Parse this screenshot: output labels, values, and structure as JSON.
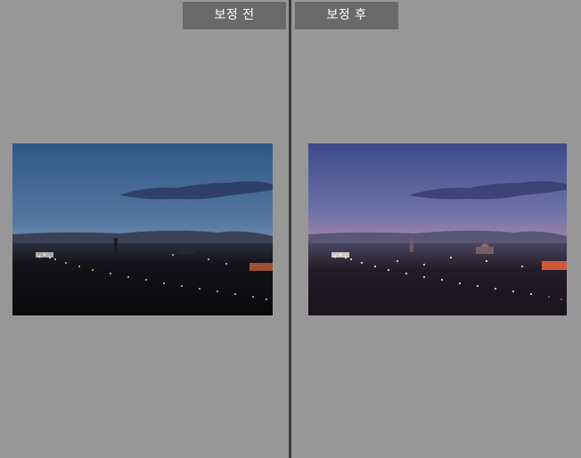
{
  "comparison": {
    "before_label": "보정 전",
    "after_label": "보정 후"
  },
  "photos": {
    "before": {
      "icon": "photo-city-dusk-before",
      "sky_top": "#3a5f8e",
      "sky_bottom": "#8fa6bf",
      "ground": "#101014"
    },
    "after": {
      "icon": "photo-city-dusk-after",
      "sky_top": "#3f4d8c",
      "sky_bottom": "#e39a8c",
      "ground": "#1a1520"
    }
  }
}
